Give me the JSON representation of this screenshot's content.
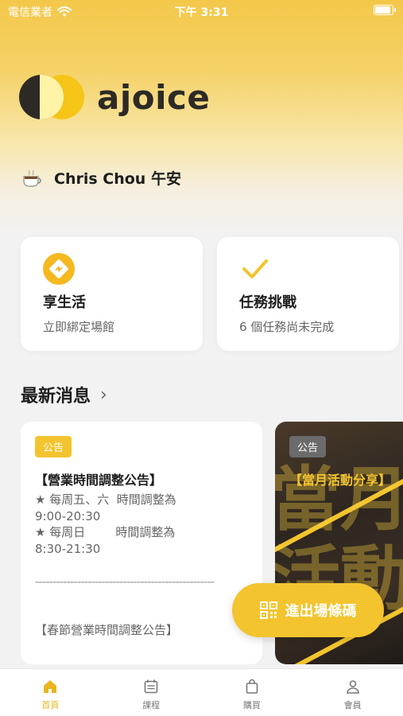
{
  "status_bar": {
    "carrier": "電信業者",
    "time": "下午 3:31"
  },
  "brand": {
    "name": "ajoice",
    "colors": {
      "accent": "#f3c42e",
      "dark": "#2d2a26"
    }
  },
  "greeting": {
    "icon": "coffee-cup-icon",
    "text": "Chris Chou 午安"
  },
  "cards": [
    {
      "icon": "diamond-arrow-icon",
      "title": "享生活",
      "subtitle": "立即綁定場館"
    },
    {
      "icon": "check-icon",
      "title": "任務挑戰",
      "subtitle": "6 個任務尚未完成"
    }
  ],
  "news": {
    "header": "最新消息",
    "items": [
      {
        "badge": "公告",
        "title": "【營業時間調整公告】",
        "body": "★ 每周五、六  時間調整為\n9:00-20:30\n★ 每周日        時間調整為\n8:30-21:30",
        "divider": "---------------------------------------------------",
        "more": "【春節營業時間調整公告】"
      },
      {
        "badge": "公告",
        "title": "【當月活動分享】",
        "image_text_1": "當月",
        "image_text_2": "活動"
      }
    ]
  },
  "fab": {
    "label": "進出場條碼",
    "icon": "qr-code-icon"
  },
  "tabs": [
    {
      "label": "首頁",
      "icon": "home-icon",
      "active": true
    },
    {
      "label": "課程",
      "icon": "calendar-icon",
      "active": false
    },
    {
      "label": "購買",
      "icon": "shopping-bag-icon",
      "active": false
    },
    {
      "label": "會員",
      "icon": "user-icon",
      "active": false
    }
  ]
}
